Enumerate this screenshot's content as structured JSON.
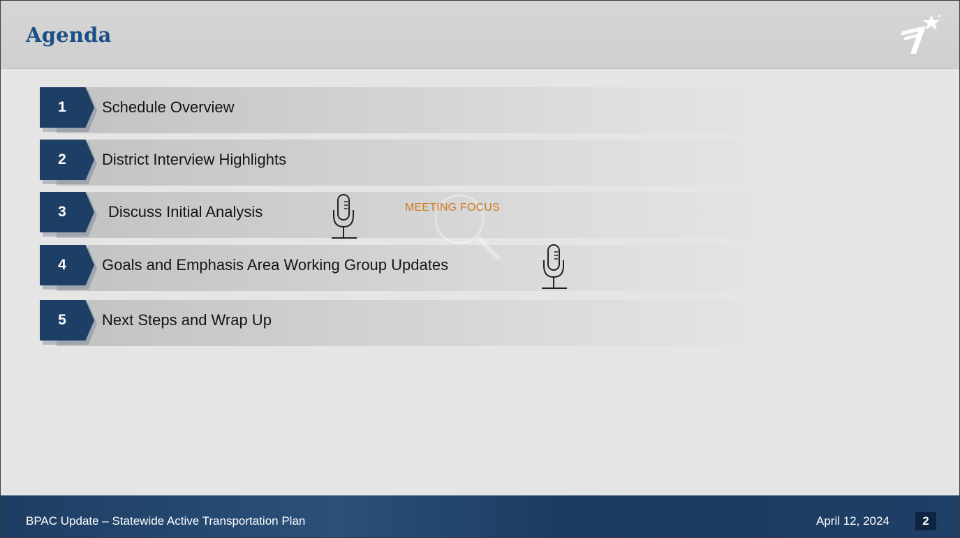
{
  "title": "Agenda",
  "agenda": [
    {
      "number": "1",
      "label": "Schedule Overview"
    },
    {
      "number": "2",
      "label": "District Interview Highlights"
    },
    {
      "number": "3",
      "label": "Discuss Initial Analysis"
    },
    {
      "number": "4",
      "label": "Goals and Emphasis Area Working Group Updates"
    },
    {
      "number": "5",
      "label": "Next Steps and Wrap Up"
    }
  ],
  "focus_label": "MEETING FOCUS",
  "footer": {
    "title": "BPAC Update – Statewide Active Transportation Plan",
    "date": "April 12, 2024",
    "page": "2"
  },
  "colors": {
    "title": "#1b5086",
    "badge": "#1d3f66",
    "focus": "#d07a22",
    "footer": "#1e3d63"
  },
  "icons": [
    "logo-star-icon",
    "microphone-icon",
    "magnifier-icon"
  ]
}
